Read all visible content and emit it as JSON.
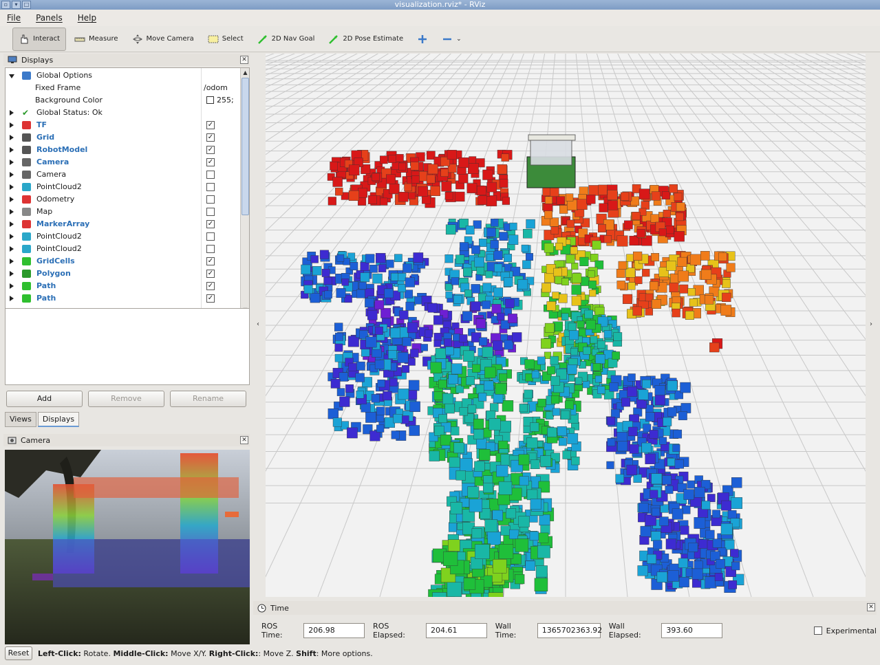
{
  "window": {
    "title": "visualization.rviz* - RViz"
  },
  "menu": [
    "File",
    "Panels",
    "Help"
  ],
  "toolbar": {
    "tools": [
      {
        "label": "Interact",
        "icon": "hand-icon",
        "active": true
      },
      {
        "label": "Measure",
        "icon": "ruler-icon",
        "active": false
      },
      {
        "label": "Move Camera",
        "icon": "move-camera-icon",
        "active": false
      },
      {
        "label": "Select",
        "icon": "select-icon",
        "active": false
      },
      {
        "label": "2D Nav Goal",
        "icon": "nav-goal-icon",
        "active": false
      },
      {
        "label": "2D Pose Estimate",
        "icon": "pose-estimate-icon",
        "active": false
      }
    ],
    "add_icon": "plus-icon",
    "remove_icon": "minus-icon"
  },
  "displays": {
    "title": "Displays",
    "items": [
      {
        "label": "Global Options",
        "value": "",
        "checked": null,
        "bold": false,
        "expanded": true,
        "icon": "gear-icon",
        "indent": 0
      },
      {
        "label": "Fixed Frame",
        "value": "/odom",
        "checked": null,
        "bold": false,
        "expanded": null,
        "icon": "",
        "indent": 1
      },
      {
        "label": "Background Color",
        "value": "255;",
        "checked": null,
        "bold": false,
        "expanded": null,
        "icon": "color-swatch",
        "indent": 1
      },
      {
        "label": "Global Status: Ok",
        "value": "",
        "checked": null,
        "bold": false,
        "expanded": false,
        "icon": "checkmark-icon",
        "indent": 0
      },
      {
        "label": "TF",
        "value": "",
        "checked": true,
        "bold": true,
        "expanded": false,
        "icon": "tf-icon",
        "indent": 0
      },
      {
        "label": "Grid",
        "value": "",
        "checked": true,
        "bold": true,
        "expanded": false,
        "icon": "grid-icon",
        "indent": 0
      },
      {
        "label": "RobotModel",
        "value": "",
        "checked": true,
        "bold": true,
        "expanded": false,
        "icon": "robot-icon",
        "indent": 0
      },
      {
        "label": "Camera",
        "value": "",
        "checked": true,
        "bold": true,
        "expanded": false,
        "icon": "camera-icon",
        "indent": 0
      },
      {
        "label": "Camera",
        "value": "",
        "checked": false,
        "bold": false,
        "expanded": false,
        "icon": "camera-icon",
        "indent": 0
      },
      {
        "label": "PointCloud2",
        "value": "",
        "checked": false,
        "bold": false,
        "expanded": false,
        "icon": "pointcloud-icon",
        "indent": 0
      },
      {
        "label": "Odometry",
        "value": "",
        "checked": false,
        "bold": false,
        "expanded": false,
        "icon": "odometry-icon",
        "indent": 0
      },
      {
        "label": "Map",
        "value": "",
        "checked": false,
        "bold": false,
        "expanded": false,
        "icon": "map-icon",
        "indent": 0
      },
      {
        "label": "MarkerArray",
        "value": "",
        "checked": true,
        "bold": true,
        "expanded": false,
        "icon": "marker-icon",
        "indent": 0
      },
      {
        "label": "PointCloud2",
        "value": "",
        "checked": false,
        "bold": false,
        "expanded": false,
        "icon": "pointcloud-icon",
        "indent": 0
      },
      {
        "label": "PointCloud2",
        "value": "",
        "checked": false,
        "bold": false,
        "expanded": false,
        "icon": "pointcloud-icon",
        "indent": 0
      },
      {
        "label": "GridCells",
        "value": "",
        "checked": true,
        "bold": true,
        "expanded": false,
        "icon": "gridcells-icon",
        "indent": 0
      },
      {
        "label": "Polygon",
        "value": "",
        "checked": true,
        "bold": true,
        "expanded": false,
        "icon": "polygon-icon",
        "indent": 0
      },
      {
        "label": "Path",
        "value": "",
        "checked": true,
        "bold": true,
        "expanded": false,
        "icon": "path-icon",
        "indent": 0
      },
      {
        "label": "Path",
        "value": "",
        "checked": true,
        "bold": true,
        "expanded": false,
        "icon": "path-icon",
        "indent": 0
      }
    ],
    "buttons": {
      "add": "Add",
      "remove": "Remove",
      "rename": "Rename"
    }
  },
  "tabs": [
    {
      "label": "Views",
      "selected": false
    },
    {
      "label": "Displays",
      "selected": true
    }
  ],
  "camera_panel": {
    "title": "Camera"
  },
  "time_panel": {
    "title": "Time",
    "ros_time_label": "ROS Time:",
    "ros_time": "206.98",
    "ros_elapsed_label": "ROS Elapsed:",
    "ros_elapsed": "204.61",
    "wall_time_label": "Wall Time:",
    "wall_time": "1365702363.92",
    "wall_elapsed_label": "Wall Elapsed:",
    "wall_elapsed": "393.60",
    "experimental_label": "Experimental",
    "experimental": false
  },
  "status": {
    "reset_label": "Reset",
    "parts": [
      {
        "text": "Left-Click:",
        "bold": true
      },
      {
        "text": " Rotate. ",
        "bold": false
      },
      {
        "text": "Middle-Click:",
        "bold": true
      },
      {
        "text": " Move X/Y. ",
        "bold": false
      },
      {
        "text": "Right-Click:",
        "bold": true
      },
      {
        "text": ": Move Z. ",
        "bold": false
      },
      {
        "text": "Shift",
        "bold": true
      },
      {
        "text": ": More options.",
        "bold": false
      }
    ]
  },
  "colors": {
    "accent": "#2b6fb6",
    "viewport_bg": "#f2f2f2",
    "grid_line": "#c8c8c8"
  }
}
